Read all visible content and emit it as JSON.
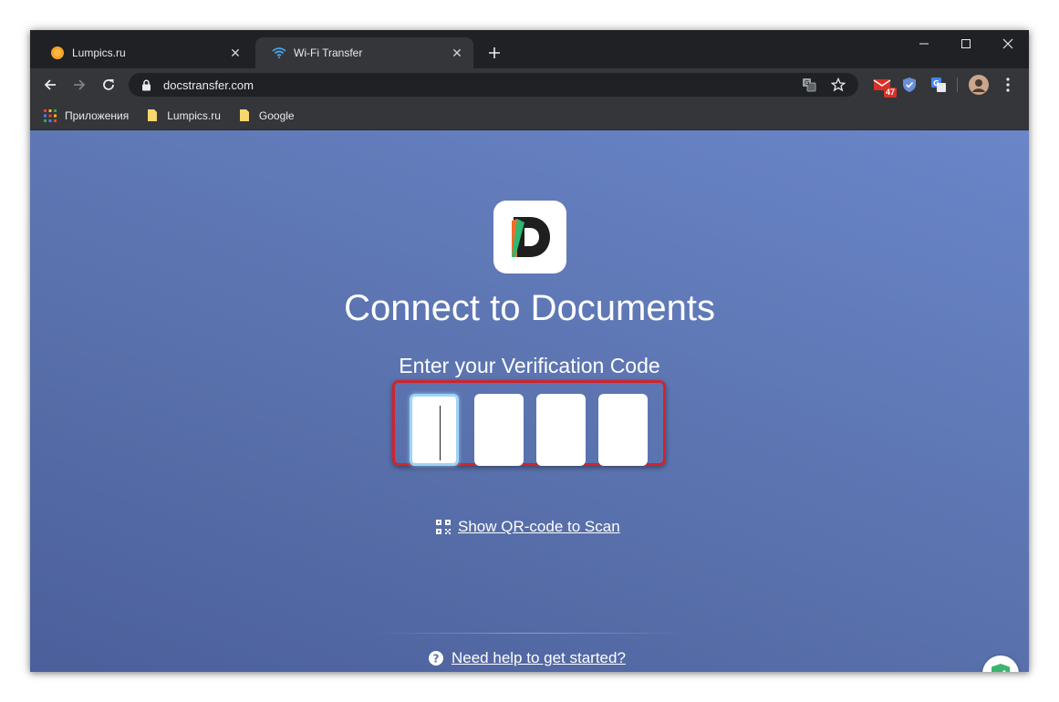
{
  "browser": {
    "tabs": [
      {
        "title": "Lumpics.ru",
        "icon": "orange-circle-icon",
        "active": false
      },
      {
        "title": "Wi-Fi Transfer",
        "icon": "wifi-icon",
        "active": true
      }
    ],
    "address": {
      "url": "docstransfer.com"
    },
    "extensions": {
      "mail_badge": "47"
    },
    "bookmarks": [
      {
        "label": "Приложения",
        "icon": "apps-grid-icon"
      },
      {
        "label": "Lumpics.ru",
        "icon": "folder-icon"
      },
      {
        "label": "Google",
        "icon": "folder-icon"
      }
    ]
  },
  "page": {
    "headline": "Connect to Documents",
    "subheading": "Enter your Verification Code",
    "code_digits": [
      "",
      "",
      "",
      ""
    ],
    "qr_link": "Show QR-code to Scan",
    "help_link": "Need help to get started?"
  },
  "colors": {
    "highlight_frame": "#d0242b",
    "focus_ring": "#9fd3f7",
    "background_start": "#4b5f9b",
    "background_end": "#6a86c9"
  }
}
